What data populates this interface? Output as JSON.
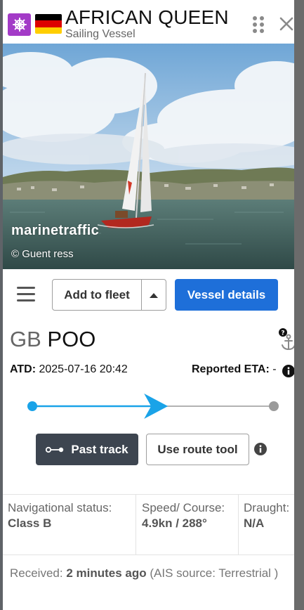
{
  "header": {
    "vessel_name": "AFRICAN QUEEN",
    "vessel_type": "Sailing Vessel",
    "type_icon": "ship-wheel-icon",
    "type_icon_color": "#a33bc7",
    "flag": "Germany",
    "flag_colors": [
      "#000000",
      "#dd0000",
      "#ffce00"
    ]
  },
  "photo": {
    "brand": "marinetraffic",
    "credit": "© Guent ress"
  },
  "toolbar": {
    "add_to_fleet": "Add to fleet",
    "vessel_details": "Vessel details",
    "accent_color": "#1e6fd9"
  },
  "callsign": {
    "country_code": "GB",
    "sign": "POO"
  },
  "voyage": {
    "atd_label": "ATD:",
    "atd_value": "2025-07-16 20:42",
    "eta_label": "Reported ETA:",
    "eta_value": "-",
    "progress_fraction": 0.55,
    "progress_color": "#1aa3e8"
  },
  "track": {
    "past_track": "Past track",
    "route_tool": "Use route tool"
  },
  "status": {
    "nav_label": "Navigational status:",
    "nav_value": "Class B",
    "speed_label": "Speed/ Course:",
    "speed_value": "4.9kn / 288°",
    "draught_label": "Draught:",
    "draught_value": "N/A"
  },
  "received": {
    "label": "Received:",
    "value": "2 minutes ago",
    "source": "(AIS source: Terrestrial )"
  }
}
